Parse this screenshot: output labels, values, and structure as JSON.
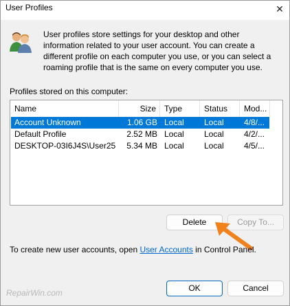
{
  "window": {
    "title": "User Profiles",
    "close_glyph": "✕"
  },
  "description": "User profiles store settings for your desktop and other information related to your user account. You can create a different profile on each computer you use, or you can select a roaming profile that is the same on every computer you use.",
  "profiles_label": "Profiles stored on this computer:",
  "table": {
    "columns": [
      "Name",
      "Size",
      "Type",
      "Status",
      "Mod..."
    ],
    "rows": [
      {
        "name": "Account Unknown",
        "size": "1.06 GB",
        "type": "Local",
        "status": "Local",
        "modified": "4/8/...",
        "selected": true
      },
      {
        "name": "Default Profile",
        "size": "2.52 MB",
        "type": "Local",
        "status": "Local",
        "modified": "4/2/...",
        "selected": false
      },
      {
        "name": "DESKTOP-03I6J4S\\User25",
        "size": "5.34 MB",
        "type": "Local",
        "status": "Local",
        "modified": "4/5/...",
        "selected": false
      }
    ]
  },
  "buttons": {
    "delete": "Delete",
    "copy_to": "Copy To...",
    "ok": "OK",
    "cancel": "Cancel"
  },
  "footer": {
    "prefix": "To create new user accounts, open ",
    "link": "User Accounts",
    "suffix": " in Control Panel."
  },
  "watermark": "RepairWin.com",
  "colors": {
    "selection": "#0078d7",
    "link": "#0066cc",
    "annotation_arrow": "#f0821e"
  },
  "icons": {
    "users": "users-icon",
    "close": "close-icon",
    "arrow": "annotation-arrow-icon"
  }
}
